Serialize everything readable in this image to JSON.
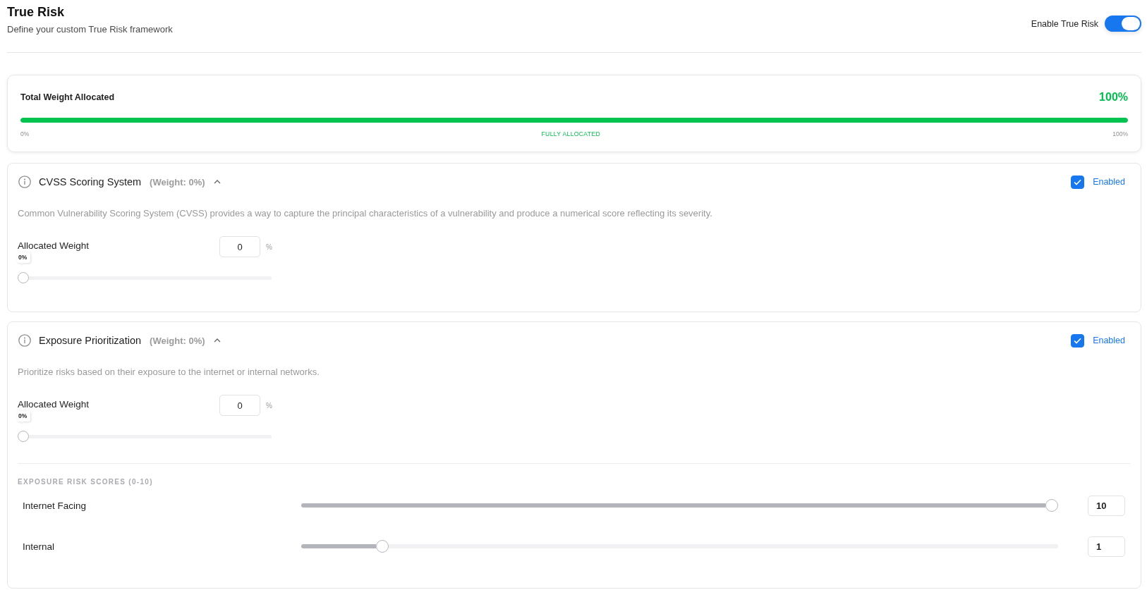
{
  "header": {
    "title": "True Risk",
    "subtitle": "Define your custom True Risk framework",
    "toggle": {
      "label": "Enable True Risk",
      "on": true
    }
  },
  "total_weight": {
    "title": "Total Weight Allocated",
    "value": "100%",
    "level": 1,
    "scale_start": "0%",
    "status": "FULLY ALLOCATED",
    "scale_end": "100%"
  },
  "sections": [
    {
      "title": "CVSS Scoring System",
      "weight": "(Weight: 0%)",
      "expanded": true,
      "enabled": {
        "label": "Enabled",
        "checked": true
      },
      "description": "Common Vulnerability Scoring System (CVSS) provides a way to capture the principal characteristics of a vulnerability and produce a numerical score reflecting its severity.",
      "allocated_weight": {
        "label": "Allocated Weight",
        "value": "0",
        "unit": "%",
        "tooltip": "0%",
        "level": 0
      }
    },
    {
      "title": "Exposure Prioritization",
      "weight": "(Weight: 0%)",
      "expanded": true,
      "enabled": {
        "label": "Enabled",
        "checked": true
      },
      "description": "Prioritize risks based on their exposure to the internet or internal networks.",
      "allocated_weight": {
        "label": "Allocated Weight",
        "value": "0",
        "unit": "%",
        "tooltip": "0%",
        "level": 0
      },
      "risk_scores": {
        "heading": "EXPOSURE RISK SCORES (0-10)",
        "rows": [
          {
            "label": "Internet Facing",
            "level": 1,
            "value": "10"
          },
          {
            "label": "Internal",
            "level": 0.1,
            "value": "1"
          }
        ]
      }
    }
  ]
}
